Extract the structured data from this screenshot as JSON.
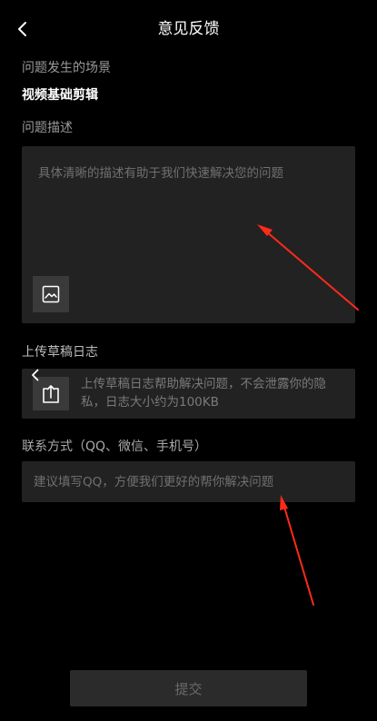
{
  "header": {
    "title": "意见反馈",
    "back_icon": "chevron-left-icon"
  },
  "scene": {
    "label": "问题发生的场景",
    "value": "视频基础剪辑"
  },
  "description": {
    "label": "问题描述",
    "placeholder": "具体清晰的描述有助于我们快速解决您的问题",
    "image_icon": "image-icon"
  },
  "upload_log": {
    "label": "上传草稿日志",
    "text": "上传草稿日志帮助解决问题，不会泄露你的隐私，日志大小约为100KB",
    "upload_icon": "upload-icon"
  },
  "contact": {
    "label": "联系方式（QQ、微信、手机号）",
    "placeholder": "建议填写QQ，方便我们更好的帮你解决问题"
  },
  "submit": {
    "label": "提交"
  },
  "colors": {
    "background": "#000000",
    "field": "#222222",
    "annotation": "#ff2a1a"
  }
}
